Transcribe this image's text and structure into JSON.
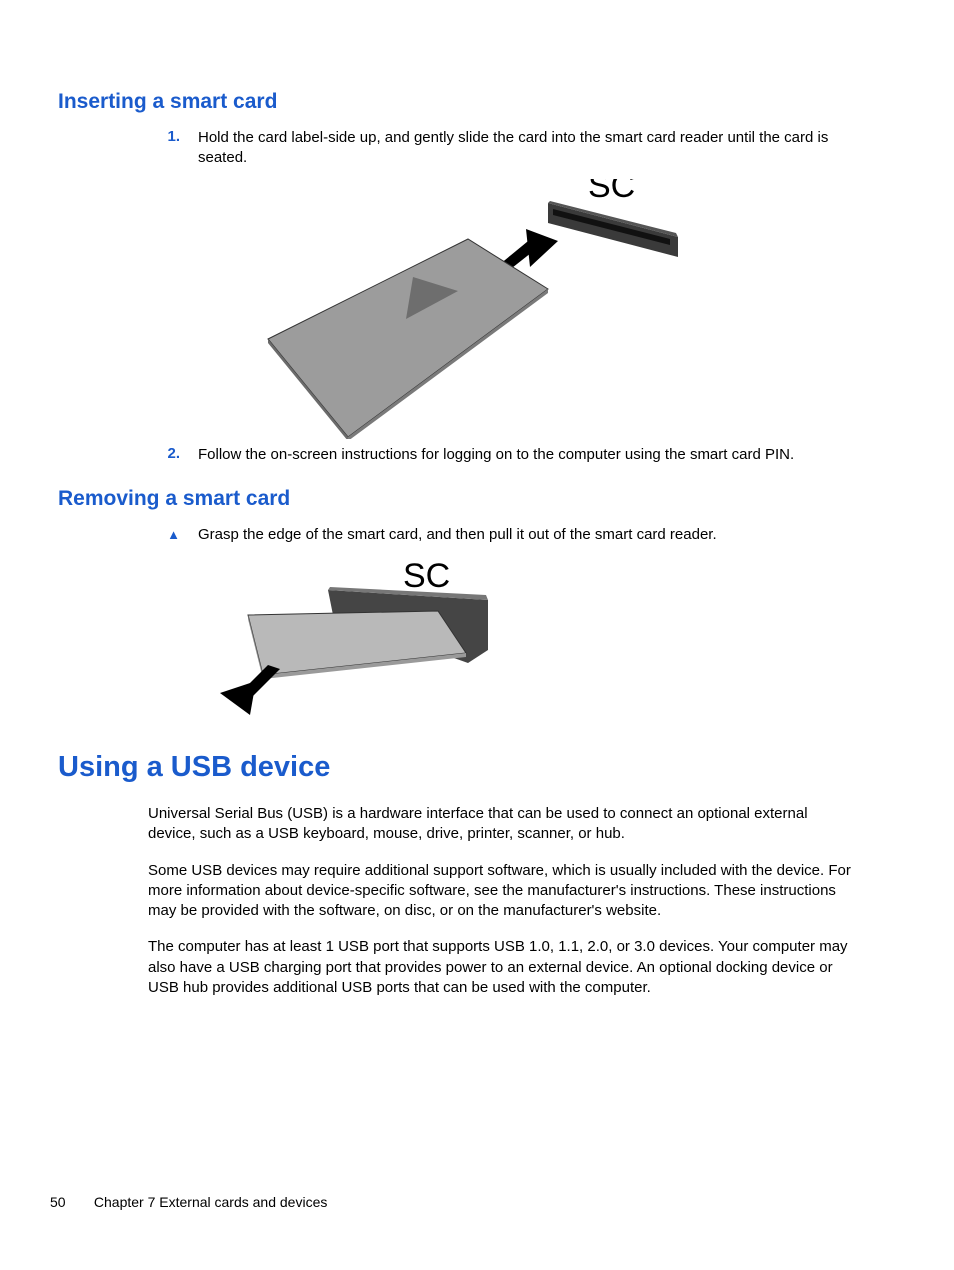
{
  "section1": {
    "heading": "Inserting a smart card",
    "step1_marker": "1.",
    "step1_text": "Hold the card label-side up, and gently slide the card into the smart card reader until the card is seated.",
    "figure_label": "SC",
    "step2_marker": "2.",
    "step2_text": "Follow the on-screen instructions for logging on to the computer using the smart card PIN."
  },
  "section2": {
    "heading": "Removing a smart card",
    "bullet_marker": "▲",
    "bullet_text": "Grasp the edge of the smart card, and then pull it out of the smart card reader.",
    "figure_label": "SC"
  },
  "section3": {
    "heading": "Using a USB device",
    "para1": "Universal Serial Bus (USB) is a hardware interface that can be used to connect an optional external device, such as a USB keyboard, mouse, drive, printer, scanner, or hub.",
    "para2": "Some USB devices may require additional support software, which is usually included with the device. For more information about device-specific software, see the manufacturer's instructions. These instructions may be provided with the software, on disc, or on the manufacturer's website.",
    "para3": "The computer has at least 1 USB port that supports USB 1.0, 1.1, 2.0, or 3.0 devices. Your computer may also have a USB charging port that provides power to an external device. An optional docking device or USB hub provides additional USB ports that can be used with the computer."
  },
  "footer": {
    "page_number": "50",
    "chapter": "Chapter 7   External cards and devices"
  }
}
